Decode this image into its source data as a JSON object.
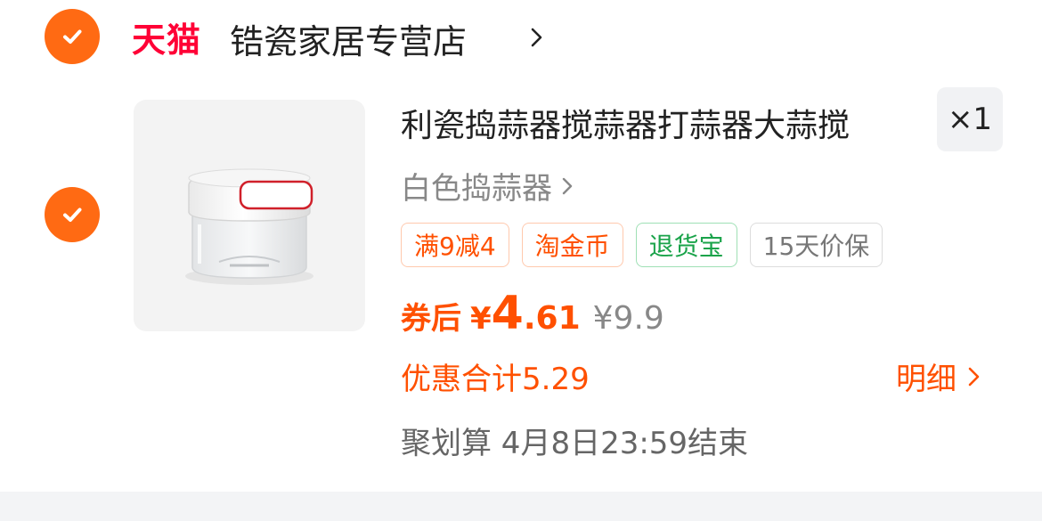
{
  "shop": {
    "platform_label": "天猫",
    "name": "锆瓷家居专营店"
  },
  "item": {
    "title": "利瓷捣蒜器搅蒜器打蒜器大蒜搅",
    "quantity": "×1",
    "sku": "白色捣蒜器",
    "tags": [
      {
        "label": "满9减4",
        "style": "orange"
      },
      {
        "label": "淘金币",
        "style": "orange"
      },
      {
        "label": "退货宝",
        "style": "green"
      },
      {
        "label": "15天价保",
        "style": "gray"
      }
    ],
    "price_label": "券后",
    "currency": "¥",
    "price_int": "4",
    "price_dec": ".61",
    "original_price": "¥9.9",
    "discount_total": "优惠合计5.29",
    "detail_label": "明细",
    "promo_info": "聚划算 4月8日23:59结束"
  },
  "colors": {
    "accent": "#ff6a13",
    "price": "#ff5000",
    "tmall_red": "#ff0036",
    "green_tag": "#1aa34a"
  },
  "icons": {
    "shop_check": "checkmark-icon",
    "item_check": "checkmark-icon",
    "shop_chevron": "chevron-right-icon",
    "sku_chevron": "chevron-right-icon",
    "detail_chevron": "chevron-right-icon"
  }
}
